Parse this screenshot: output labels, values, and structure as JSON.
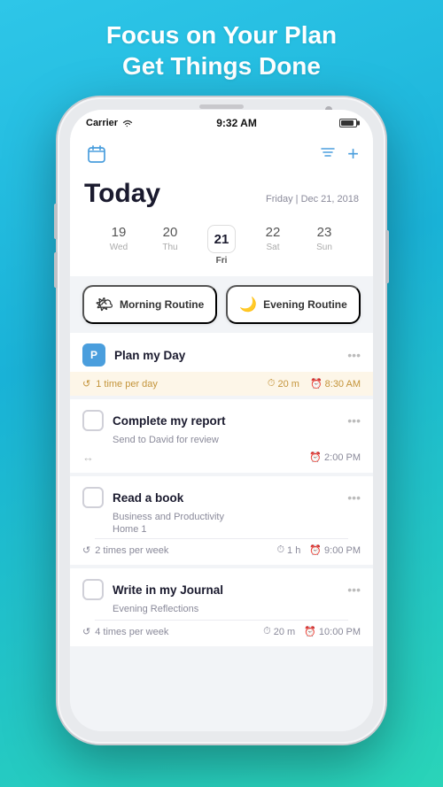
{
  "headline": {
    "line1": "Focus on Your Plan",
    "line2": "Get Things Done"
  },
  "status_bar": {
    "carrier": "Carrier",
    "time": "9:32 AM"
  },
  "header": {
    "title": "Today",
    "date": "Friday | Dec 21, 2018"
  },
  "calendar": {
    "days": [
      {
        "num": "19",
        "name": "Wed",
        "active": false
      },
      {
        "num": "20",
        "name": "Thu",
        "active": false
      },
      {
        "num": "21",
        "name": "Fri",
        "active": true
      },
      {
        "num": "22",
        "name": "Sat",
        "active": false
      },
      {
        "num": "23",
        "name": "Sun",
        "active": false
      }
    ]
  },
  "routines": {
    "morning": "Morning Routine",
    "evening": "Evening Routine"
  },
  "tasks": [
    {
      "id": "plan-my-day",
      "type": "plan",
      "icon_label": "P",
      "title": "Plan my Day",
      "freq": "1 time per day",
      "duration": "20 m",
      "time": "8:30 AM"
    },
    {
      "id": "complete-report",
      "type": "task",
      "title": "Complete my report",
      "subtitle": "Send to David for review",
      "time": "2:00 PM"
    },
    {
      "id": "read-book",
      "type": "task",
      "title": "Read a book",
      "subtitle": "Business and Productivity",
      "tag": "Home 1",
      "freq": "2 times per week",
      "duration": "1 h",
      "time": "9:00 PM"
    },
    {
      "id": "journal",
      "type": "task",
      "title": "Write in my Journal",
      "subtitle": "Evening Reflections",
      "freq": "4 times per week",
      "duration": "20 m",
      "time": "10:00 PM"
    }
  ],
  "icons": {
    "calendar": "📅",
    "filter": "⊟",
    "add": "+",
    "morning_emoji": "🌤",
    "evening_emoji": "🌙",
    "repeat": "↺",
    "clock": "⏱",
    "time_clock": "⏰",
    "expand": "↔"
  }
}
